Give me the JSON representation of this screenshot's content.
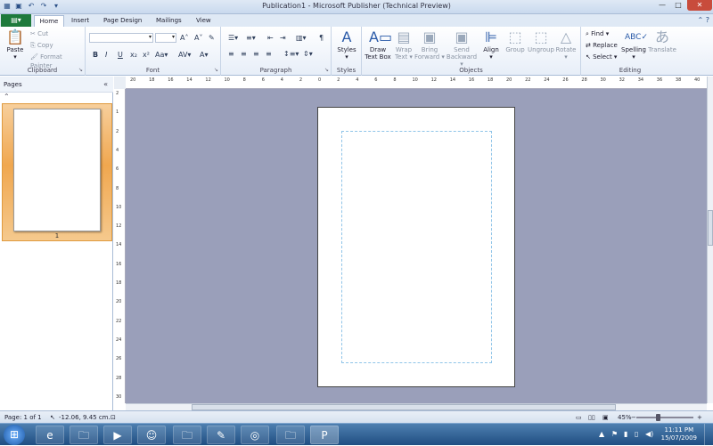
{
  "window": {
    "title": "Publication1 - Microsoft Publisher (Technical Preview)",
    "controls": {
      "minimize": "—",
      "maximize": "□",
      "close": "✕"
    }
  },
  "tabs": {
    "file_label": "▤▾",
    "items": [
      "Home",
      "Insert",
      "Page Design",
      "Mailings",
      "View"
    ],
    "active": "Home"
  },
  "ribbon": {
    "clipboard": {
      "label": "Clipboard",
      "paste": "Paste",
      "cut": "Cut",
      "copy": "Copy",
      "format_painter": "Format Painter"
    },
    "font": {
      "label": "Font",
      "font_name": "",
      "font_size": ""
    },
    "paragraph": {
      "label": "Paragraph"
    },
    "styles": {
      "label": "Styles",
      "styles_button": "Styles"
    },
    "objects": {
      "label": "Objects",
      "draw_text_box_1": "Draw",
      "draw_text_box_2": "Text Box",
      "wrap_text_1": "Wrap",
      "wrap_text_2": "Text ▾",
      "bring_forward_1": "Bring",
      "bring_forward_2": "Forward ▾",
      "send_backward_1": "Send",
      "send_backward_2": "Backward ▾",
      "align_1": "Align",
      "align_2": "▾",
      "group": "Group",
      "ungroup": "Ungroup",
      "rotate_1": "Rotate",
      "rotate_2": "▾"
    },
    "editing": {
      "label": "Editing",
      "find": "Find ▾",
      "replace": "Replace",
      "select": "Select ▾",
      "spelling_1": "Spelling",
      "spelling_2": "▾",
      "translate": "Translate"
    }
  },
  "pages_panel": {
    "title": "Pages",
    "collapse": "«",
    "scroll_up": "⌃",
    "thumbnail_number": "1"
  },
  "rulers": {
    "horizontal": [
      "20",
      "18",
      "16",
      "14",
      "12",
      "10",
      "8",
      "6",
      "4",
      "2",
      "0",
      "2",
      "4",
      "6",
      "8",
      "10",
      "12",
      "14",
      "16",
      "18",
      "20",
      "22",
      "24",
      "26",
      "28",
      "30",
      "32",
      "34",
      "36",
      "38",
      "40"
    ],
    "vertical": [
      "2",
      "1",
      "2",
      "4",
      "6",
      "8",
      "10",
      "12",
      "14",
      "16",
      "18",
      "20",
      "22",
      "24",
      "26",
      "28",
      "30"
    ]
  },
  "statusbar": {
    "page": "Page: 1 of 1",
    "position": "-12.06, 9.45 cm.",
    "zoom": "45%",
    "zoom_out": "−",
    "zoom_in": "+"
  },
  "taskbar": {
    "start": "⊞",
    "items": [
      {
        "name": "internet-explorer",
        "glyph": "e"
      },
      {
        "name": "windows-explorer",
        "glyph": "🗀"
      },
      {
        "name": "media-player",
        "glyph": "▶"
      },
      {
        "name": "messenger",
        "glyph": "☺"
      },
      {
        "name": "folder",
        "glyph": "🗀"
      },
      {
        "name": "app-bird",
        "glyph": "✎"
      },
      {
        "name": "disc-app",
        "glyph": "◎"
      },
      {
        "name": "notes-folder",
        "glyph": "🗀"
      },
      {
        "name": "publisher",
        "glyph": "P"
      }
    ],
    "tray": {
      "arrow": "▲",
      "flag": "⚑",
      "network": "▮",
      "volume": "◀)"
    },
    "time": "11:11 PM",
    "date": "15/07/2009"
  },
  "colors": {
    "workspace": "#9a9fba",
    "accent_file": "#1e7a3c",
    "thumb_highlight": "#f0a74f"
  }
}
